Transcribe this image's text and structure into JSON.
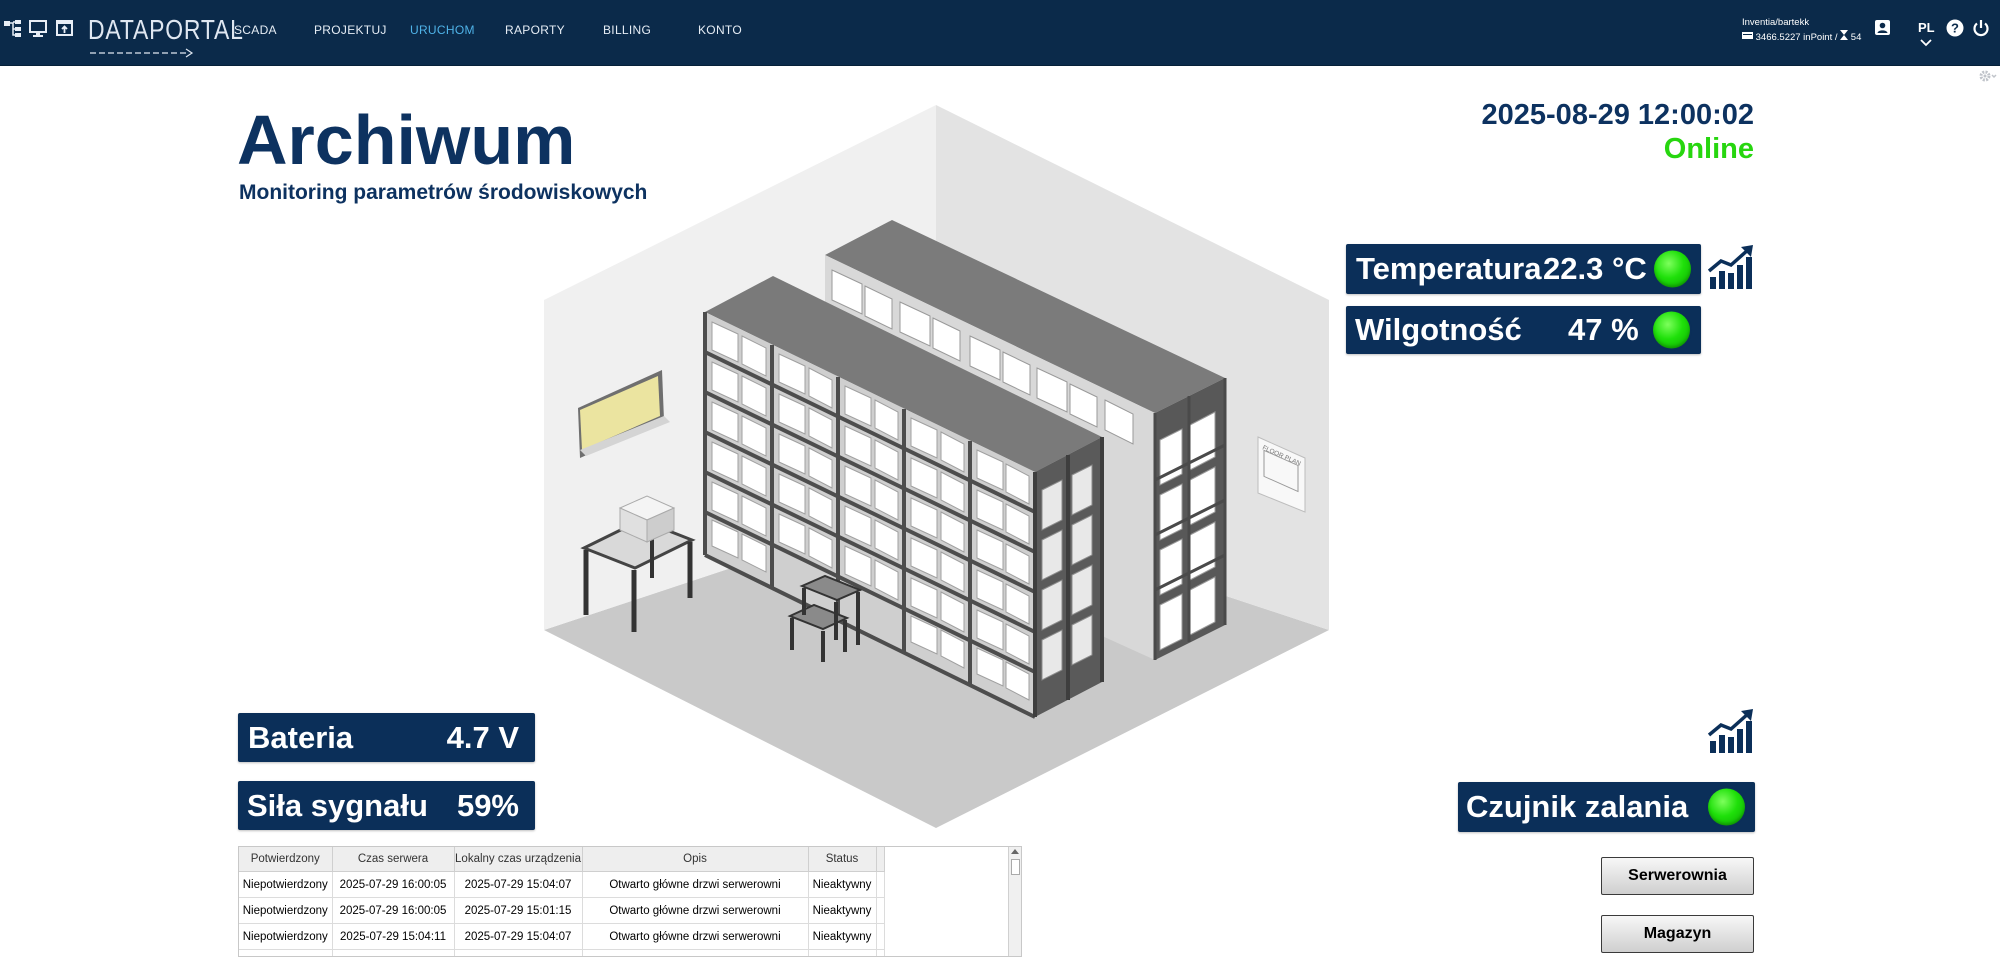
{
  "topbar": {
    "logo": "DATAPORTAL",
    "nav": [
      "SCADA",
      "PROJEKTUJ",
      "URUCHOM",
      "RAPORTY",
      "BILLING",
      "KONTO"
    ],
    "active_nav": "URUCHOM",
    "user": "Inventia/bartekk",
    "balance": "3466.5227 inPoint / ",
    "devices": "54",
    "language": "PL"
  },
  "header": {
    "title": "Archiwum",
    "subtitle": "Monitoring parametrów środowiskowych",
    "datetime": "2025-08-29 12:00:02",
    "status": "Online"
  },
  "sensors": {
    "temperature": {
      "label": "Temperatura",
      "value": "22.3 °C"
    },
    "humidity": {
      "label": "Wilgotność",
      "value": "47 %"
    },
    "battery": {
      "label": "Bateria",
      "value": "4.7 V"
    },
    "signal": {
      "label": "Siła sygnału",
      "value": "59%"
    },
    "flood": {
      "label": "Czujnik zalania"
    }
  },
  "scene": {
    "floor_plan_label": "FLOOR PLAN"
  },
  "buttons": {
    "serwerownia": "Serwerownia",
    "magazyn": "Magazyn"
  },
  "events": {
    "columns": [
      "Potwierdzony",
      "Czas serwera",
      "Lokalny czas urządzenia",
      "Opis",
      "Status"
    ],
    "rows": [
      [
        "Niepotwierdzony",
        "2025-07-29 16:00:05",
        "2025-07-29 15:04:07",
        "Otwarto główne drzwi serwerowni",
        "Nieaktywny"
      ],
      [
        "Niepotwierdzony",
        "2025-07-29 16:00:05",
        "2025-07-29 15:01:15",
        "Otwarto główne drzwi serwerowni",
        "Nieaktywny"
      ],
      [
        "Niepotwierdzony",
        "2025-07-29 15:04:11",
        "2025-07-29 15:04:07",
        "Otwarto główne drzwi serwerowni",
        "Nieaktywny"
      ]
    ]
  },
  "colors": {
    "topbar": "#0b2a4a",
    "panel": "#0b2f59",
    "title": "#0d3260",
    "online": "#27d60f",
    "led": "#1fe00a",
    "active_nav": "#4fb3e8"
  },
  "icons": {
    "tool1": "tree-structure-icon",
    "tool2": "monitor-icon",
    "tool3": "window-upload-icon",
    "user": "user-card-icon",
    "help": "help-icon",
    "power": "power-icon",
    "trend": "trend-chart-icon",
    "gear": "gear-icon"
  }
}
